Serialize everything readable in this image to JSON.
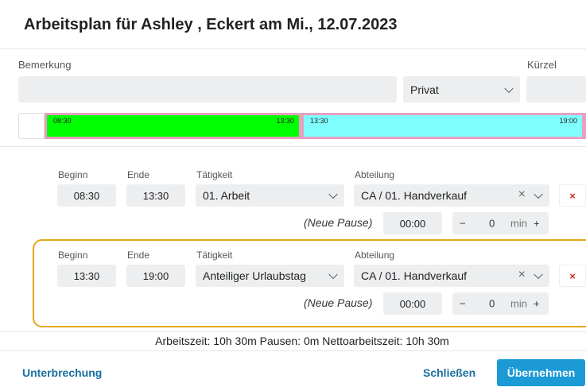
{
  "dialog": {
    "title": "Arbeitsplan für Ashley , Eckert am Mi., 12.07.2023",
    "bemerkung_label": "Bemerkung",
    "privacy_value": "Privat",
    "kuerzel_label": "Kürzel"
  },
  "timeline": {
    "segments": [
      {
        "start": "08:30",
        "end": "13:30",
        "color": "#00ff00"
      },
      {
        "start": "13:30",
        "end": "19:00",
        "color": "#80ffff"
      }
    ],
    "border_color": "#e8a0c0"
  },
  "labels": {
    "beginn": "Beginn",
    "ende": "Ende",
    "taetigkeit": "Tätigkeit",
    "abteilung": "Abteilung",
    "neue_pause": "(Neue Pause)",
    "min": "min"
  },
  "entries": [
    {
      "beginn": "08:30",
      "ende": "13:30",
      "taetigkeit": "01. Arbeit",
      "abteilung": "CA / 01. Handverkauf",
      "pause_time": "00:00",
      "pause_minutes": "0",
      "highlighted": false
    },
    {
      "beginn": "13:30",
      "ende": "19:00",
      "taetigkeit": "Anteiliger Urlaubstag",
      "abteilung": "CA / 01. Handverkauf",
      "pause_time": "00:00",
      "pause_minutes": "0",
      "highlighted": true
    }
  ],
  "icons": {
    "clear": "×",
    "delete": "×",
    "minus": "−",
    "plus": "+"
  },
  "summary": "Arbeitszeit: 10h 30m Pausen: 0m Nettoarbeitszeit: 10h 30m",
  "footer": {
    "interrupt_label": "Unterbrechung",
    "close_label": "Schließen",
    "apply_label": "Übernehmen"
  },
  "colors": {
    "accent": "#1b9ad6",
    "link": "#1a6fa0",
    "highlight": "#e6a817",
    "delete": "#d42a2a"
  }
}
